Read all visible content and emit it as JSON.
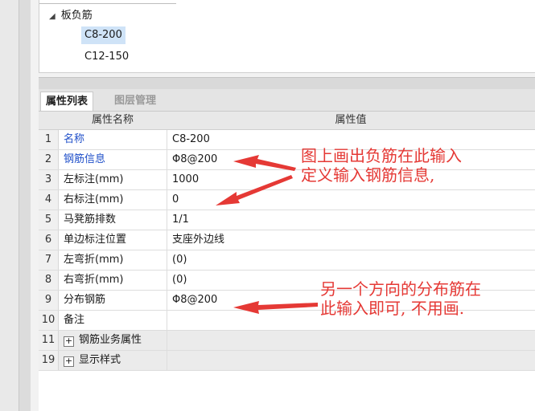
{
  "tree": {
    "root_label": "板负筋",
    "children": [
      "C8-200",
      "C12-150"
    ],
    "selected_index": 0
  },
  "tabs": [
    {
      "label": "属性列表",
      "active": true
    },
    {
      "label": "图层管理",
      "active": false
    }
  ],
  "grid": {
    "headers": [
      "属性名称",
      "属性值"
    ],
    "rows": [
      {
        "num": "1",
        "name": "名称",
        "value": "C8-200",
        "highlight": true
      },
      {
        "num": "2",
        "name": "钢筋信息",
        "value": "Φ8@200",
        "highlight": true
      },
      {
        "num": "3",
        "name": "左标注(mm)",
        "value": "1000"
      },
      {
        "num": "4",
        "name": "右标注(mm)",
        "value": "0"
      },
      {
        "num": "5",
        "name": "马凳筋排数",
        "value": "1/1"
      },
      {
        "num": "6",
        "name": "单边标注位置",
        "value": "支座外边线"
      },
      {
        "num": "7",
        "name": "左弯折(mm)",
        "value": "(0)"
      },
      {
        "num": "8",
        "name": "右弯折(mm)",
        "value": "(0)"
      },
      {
        "num": "9",
        "name": "分布钢筋",
        "value": "Φ8@200"
      },
      {
        "num": "10",
        "name": "备注",
        "value": ""
      },
      {
        "num": "11",
        "name": "钢筋业务属性",
        "value": "",
        "group": true
      },
      {
        "num": "19",
        "name": "显示样式",
        "value": "",
        "group": true
      }
    ]
  },
  "annotations": {
    "note1_line1": "图上画出负筋在此输入",
    "note1_line2": "定义输入钢筋信息,",
    "note2_line1": "另一个方向的分布筋在",
    "note2_line2": "此输入即可, 不用画."
  },
  "colors": {
    "annotation": "#e53935",
    "highlight_name": "#1f4fc9",
    "selected_tree": "#cfe3f7"
  }
}
